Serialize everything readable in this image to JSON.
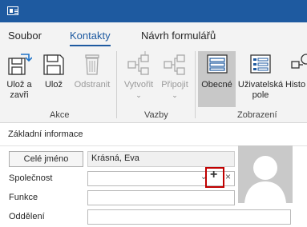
{
  "menu": {
    "tabs": [
      {
        "label": "Soubor"
      },
      {
        "label": "Kontakty",
        "active": true
      },
      {
        "label": "Návrh formulářů"
      }
    ]
  },
  "ribbon": {
    "groups": [
      {
        "label": "Akce",
        "buttons": [
          {
            "label_line1": "Ulož a",
            "label_line2": "zavři",
            "icon": "save-close-icon"
          },
          {
            "label_line1": "Ulož",
            "label_line2": "",
            "icon": "save-icon"
          },
          {
            "label_line1": "Odstranit",
            "label_line2": "",
            "icon": "trash-icon",
            "disabled": true
          }
        ]
      },
      {
        "label": "Vazby",
        "buttons": [
          {
            "label_line1": "Vytvořit",
            "label_line2": "",
            "icon": "create-link-icon",
            "disabled": true,
            "dropdown": true
          },
          {
            "label_line1": "Připojit",
            "label_line2": "",
            "icon": "attach-icon",
            "disabled": true,
            "dropdown": true
          }
        ]
      },
      {
        "label": "Zobrazení",
        "buttons": [
          {
            "label_line1": "Obecné",
            "label_line2": "",
            "icon": "general-form-icon",
            "selected": true
          },
          {
            "label_line1": "Uživatelská",
            "label_line2": "pole",
            "icon": "custom-fields-icon"
          },
          {
            "label_line1": "Histo",
            "label_line2": "",
            "icon": "history-icon"
          }
        ]
      }
    ]
  },
  "form": {
    "section_title": "Základní informace",
    "fullname_button": "Celé jméno",
    "fullname_value": "Krásná, Eva",
    "company_label": "Společnost",
    "company_value": "",
    "company_add_symbol": "+",
    "company_clear_symbol": "×",
    "function_label": "Funkce",
    "function_value": "",
    "department_label": "Oddělení",
    "department_value": ""
  },
  "colors": {
    "titlebar": "#1e5aa0",
    "accent": "#1e5aa0",
    "ribbon_bg": "#f3f3f3",
    "highlight": "#c00000"
  }
}
